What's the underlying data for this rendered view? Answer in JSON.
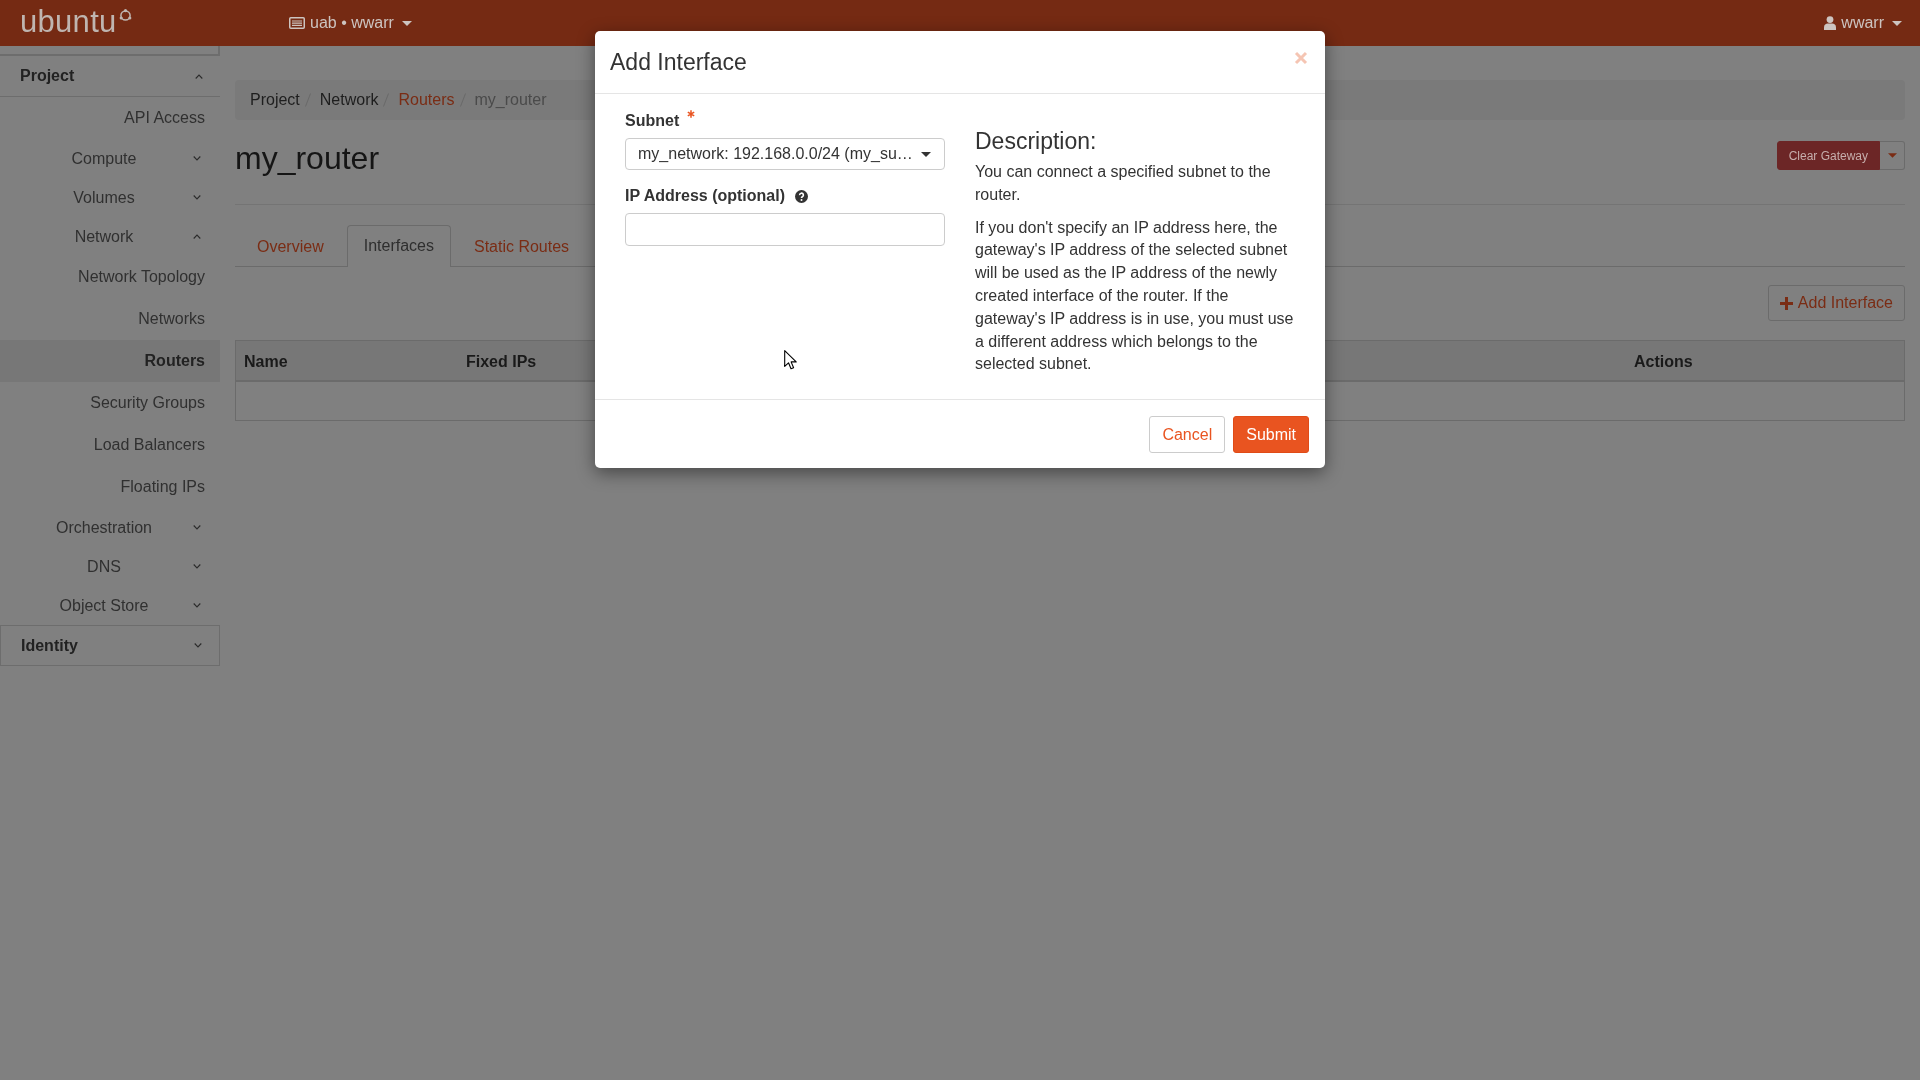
{
  "navbar": {
    "logo": "ubuntu",
    "project_menu": "uab • wwarr",
    "user_menu": "wwarr"
  },
  "sidebar": {
    "sections": [
      {
        "label": "Project",
        "expanded": true,
        "items": [
          {
            "kind": "link",
            "label": "API Access",
            "selected": false
          },
          {
            "kind": "group",
            "label": "Compute",
            "expanded": false
          },
          {
            "kind": "group",
            "label": "Volumes",
            "expanded": false
          },
          {
            "kind": "group",
            "label": "Network",
            "expanded": true,
            "children": [
              {
                "label": "Network Topology",
                "selected": false
              },
              {
                "label": "Networks",
                "selected": false
              },
              {
                "label": "Routers",
                "selected": true
              },
              {
                "label": "Security Groups",
                "selected": false
              },
              {
                "label": "Load Balancers",
                "selected": false
              },
              {
                "label": "Floating IPs",
                "selected": false
              }
            ]
          },
          {
            "kind": "group",
            "label": "Orchestration",
            "expanded": false
          },
          {
            "kind": "group",
            "label": "DNS",
            "expanded": false
          },
          {
            "kind": "group",
            "label": "Object Store",
            "expanded": false
          }
        ]
      },
      {
        "label": "Identity",
        "expanded": false
      }
    ]
  },
  "breadcrumb": [
    {
      "kind": "text",
      "label": "Project"
    },
    {
      "kind": "text",
      "label": "Network"
    },
    {
      "kind": "link",
      "label": "Routers"
    },
    {
      "kind": "current",
      "label": "my_router"
    }
  ],
  "page": {
    "title": "my_router",
    "header_action": "Clear Gateway"
  },
  "tabs": [
    {
      "label": "Overview",
      "selected": false
    },
    {
      "label": "Interfaces",
      "selected": true
    },
    {
      "label": "Static Routes",
      "selected": false
    }
  ],
  "table_actions": [
    {
      "label": "Add Interface"
    }
  ],
  "table": {
    "columns": [
      "Name",
      "Fixed IPs",
      "Actions"
    ]
  },
  "dialog": {
    "title": "Add Interface",
    "fields": [
      {
        "kind": "select",
        "label": "Subnet",
        "required": true,
        "value": "my_network: 192.168.0.0/24 (my_su…"
      },
      {
        "kind": "text",
        "label": "IP Address (optional)",
        "help": true
      }
    ],
    "description": {
      "heading": "Description:",
      "paragraphs": [
        "You can connect a specified subnet to the router.",
        "If you don't specify an IP address here, the gateway's IP address of the selected subnet will be used as the IP address of the newly created interface of the router. If the gateway's IP address is in use, you must use a different address which belongs to the selected subnet."
      ]
    },
    "buttons": [
      {
        "kind": "secondary",
        "label": "Cancel"
      },
      {
        "kind": "primary",
        "label": "Submit"
      }
    ]
  }
}
